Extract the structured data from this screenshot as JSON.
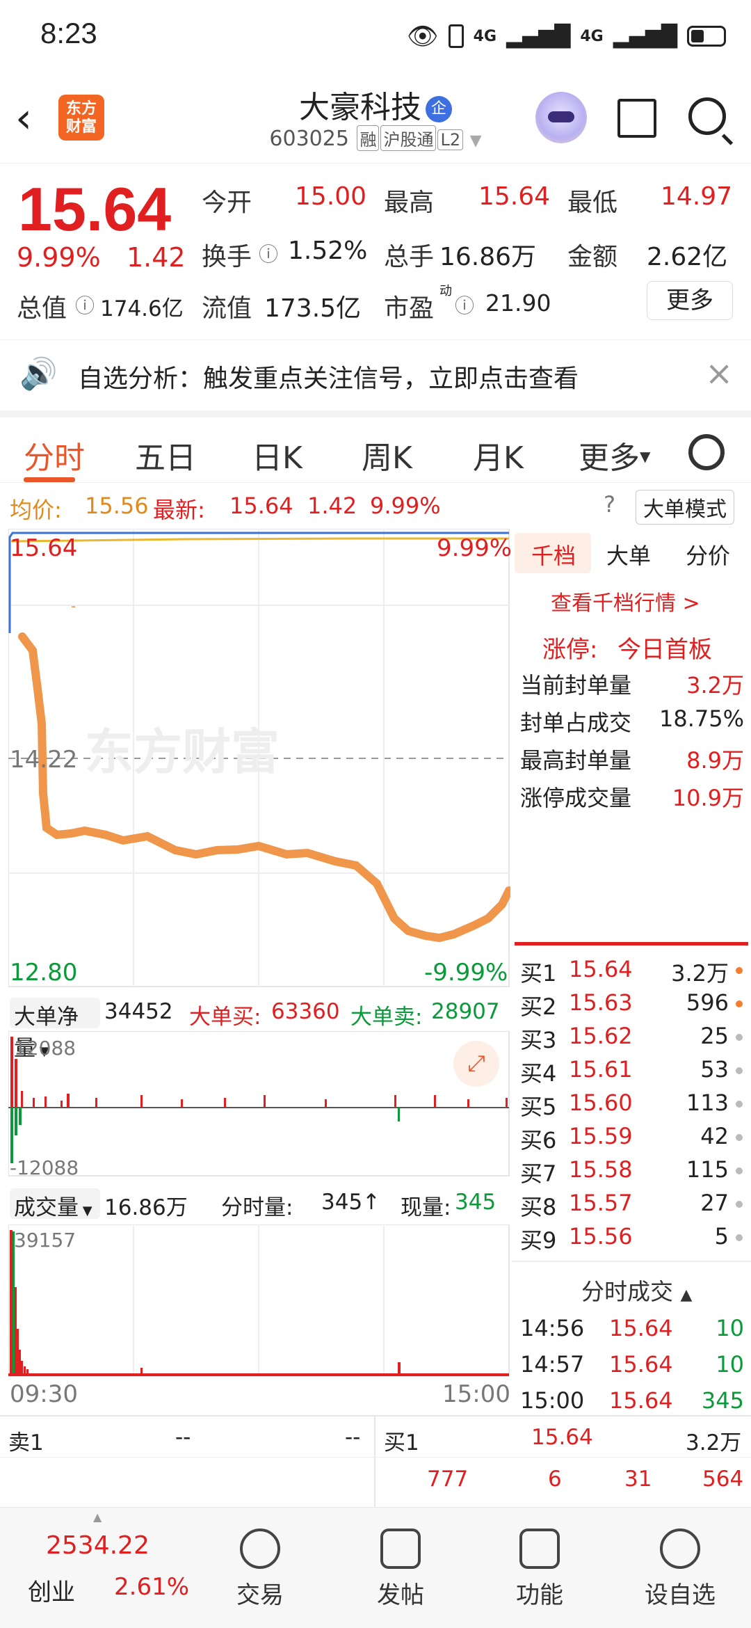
{
  "status_bar": {
    "time": "8:23",
    "signal1": "4G",
    "signal2": "4G"
  },
  "header": {
    "logo_line1": "东方",
    "logo_line2": "财富",
    "stock_name": "大豪科技",
    "badge": "企",
    "code": "603025",
    "tags": [
      "融",
      "沪股通",
      "L2"
    ]
  },
  "quote": {
    "price": "15.64",
    "change_pct": "9.99%",
    "change": "1.42",
    "rows": [
      [
        {
          "label": "今开",
          "value": "15.00",
          "color": "red"
        },
        {
          "label": "最高",
          "value": "15.64",
          "color": "red"
        },
        {
          "label": "最低",
          "value": "14.97",
          "color": "red"
        }
      ],
      [
        {
          "label": "换手",
          "value": "1.52%",
          "color": "dark"
        },
        {
          "label": "总手",
          "value": "16.86万",
          "color": "dark"
        },
        {
          "label": "金额",
          "value": "2.62亿",
          "color": "dark"
        }
      ],
      [
        {
          "label": "总值",
          "value": "174.6亿",
          "color": "dark"
        },
        {
          "label": "流值",
          "value": "173.5亿",
          "color": "dark"
        },
        {
          "label": "市盈",
          "value": "21.90",
          "color": "dark",
          "super": "动"
        }
      ]
    ],
    "more": "更多"
  },
  "notice": {
    "text": "自选分析：触发重点关注信号，立即点击查看"
  },
  "tabs": [
    "分时",
    "五日",
    "日K",
    "周K",
    "月K",
    "更多"
  ],
  "info_line": {
    "avg_label": "均价:",
    "avg_value": "15.56",
    "latest_label": "最新:",
    "latest_value": "15.64",
    "latest_change": "1.42",
    "latest_pct": "9.99%",
    "mode": "大单模式"
  },
  "main_chart": {
    "y_top": "15.64",
    "y_mid": "14.22",
    "y_bottom": "12.80",
    "pct_top": "9.99%",
    "pct_bottom": "-9.99%",
    "watermark": "东方财富"
  },
  "big_order": {
    "label": "大单净量",
    "value": "34452",
    "buy_label": "大单买:",
    "buy_value": "63360",
    "sell_label": "大单卖:",
    "sell_value": "28907",
    "y_top": "12088",
    "y_bottom": "-12088"
  },
  "volume": {
    "label": "成交量",
    "total": "16.86万",
    "fs_label": "分时量:",
    "fs_value": "345",
    "now_label": "现量:",
    "now_value": "345",
    "y_top": "39157",
    "x_start": "09:30",
    "x_end": "15:00"
  },
  "right_panel": {
    "tabs": [
      "千档",
      "大单",
      "分价"
    ],
    "link": "查看千档行情 >",
    "limit_label": "涨停:",
    "limit_value": "今日首板",
    "stats": [
      {
        "label": "当前封单量",
        "value": "3.2万",
        "color": "red"
      },
      {
        "label": "封单占成交",
        "value": "18.75%",
        "color": "dark"
      },
      {
        "label": "最高封单量",
        "value": "8.9万",
        "color": "red"
      },
      {
        "label": "涨停成交量",
        "value": "10.9万",
        "color": "red"
      }
    ],
    "bids": [
      {
        "label": "买1",
        "price": "15.64",
        "vol": "3.2万",
        "dot": "orange"
      },
      {
        "label": "买2",
        "price": "15.63",
        "vol": "596",
        "dot": "orange"
      },
      {
        "label": "买3",
        "price": "15.62",
        "vol": "25",
        "dot": "gray"
      },
      {
        "label": "买4",
        "price": "15.61",
        "vol": "53",
        "dot": "gray"
      },
      {
        "label": "买5",
        "price": "15.60",
        "vol": "113",
        "dot": "gray"
      },
      {
        "label": "买6",
        "price": "15.59",
        "vol": "42",
        "dot": "gray"
      },
      {
        "label": "买7",
        "price": "15.58",
        "vol": "115",
        "dot": "gray"
      },
      {
        "label": "买8",
        "price": "15.57",
        "vol": "27",
        "dot": "gray"
      },
      {
        "label": "买9",
        "price": "15.56",
        "vol": "5",
        "dot": "gray"
      }
    ],
    "ticks_title": "分时成交",
    "ticks": [
      {
        "time": "14:56",
        "price": "15.64",
        "vol": "10"
      },
      {
        "time": "14:57",
        "price": "15.64",
        "vol": "10"
      },
      {
        "time": "15:00",
        "price": "15.64",
        "vol": "345"
      }
    ]
  },
  "bottom_quote": {
    "sell1_label": "卖1",
    "sell1_price": "--",
    "sell1_vol": "--",
    "buy1_label": "买1",
    "buy1_price": "15.64",
    "buy1_vol": "3.2万",
    "queue": [
      "777",
      "6",
      "31",
      "564"
    ]
  },
  "nav": {
    "index_value": "2534.22",
    "index_name": "创业",
    "index_pct": "2.61%",
    "items": [
      "交易",
      "发帖",
      "功能",
      "设自选"
    ]
  }
}
